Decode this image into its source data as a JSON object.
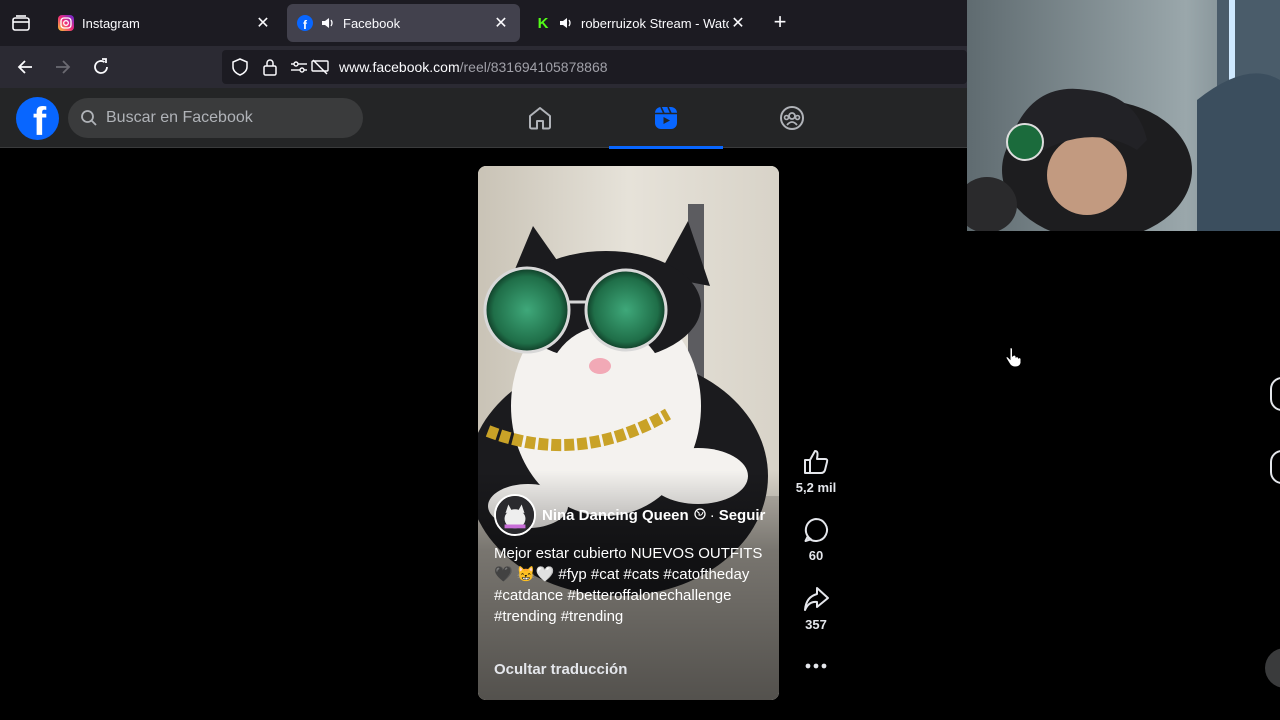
{
  "browser": {
    "tabs": [
      {
        "title": "Instagram",
        "favicon": "instagram-icon",
        "active": false
      },
      {
        "title": "Facebook",
        "favicon": "facebook-icon",
        "active": true,
        "audio": true
      },
      {
        "title": "roberruizok Stream - Watch",
        "favicon": "kick-icon",
        "active": false,
        "audio": true
      }
    ],
    "url_domain": "www.facebook.com",
    "url_path": "/reel/831694105878868"
  },
  "facebook": {
    "search_placeholder": "Buscar en Facebook",
    "nav": [
      "home-icon",
      "reels-icon",
      "groups-icon"
    ],
    "active_nav": "reels-icon",
    "brand_color": "#0866ff"
  },
  "reel": {
    "author": "Nina Dancing Queen",
    "audience_icon": "globe-icon",
    "separator": "·",
    "follow_label": "Seguir",
    "caption": "Mejor estar cubierto NUEVOS OUTFITS 🖤 😸🤍 #fyp #cat #cats #catoftheday #catdance #betteroffalonechallenge #trending #trending",
    "translate_label": "Ocultar traducción",
    "likes": "5,2 mil",
    "comments": "60",
    "shares": "357"
  }
}
